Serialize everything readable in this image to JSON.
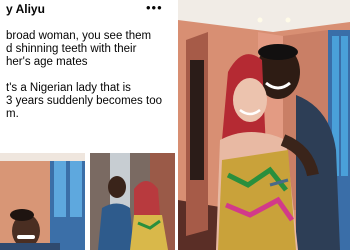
{
  "post": {
    "author": "y Aliyu",
    "more_icon": "more-dots-icon",
    "lines": [
      "broad woman, you see them",
      "d shinning teeth with their",
      "her's age mates",
      "",
      "t's a Nigerian lady that is",
      "3 years suddenly becomes too",
      "m."
    ]
  },
  "colors": {
    "wall_left": "#d88f73",
    "wall_right": "#e39b83",
    "ceiling": "#f1ece6",
    "window": "#4aa0d9"
  }
}
